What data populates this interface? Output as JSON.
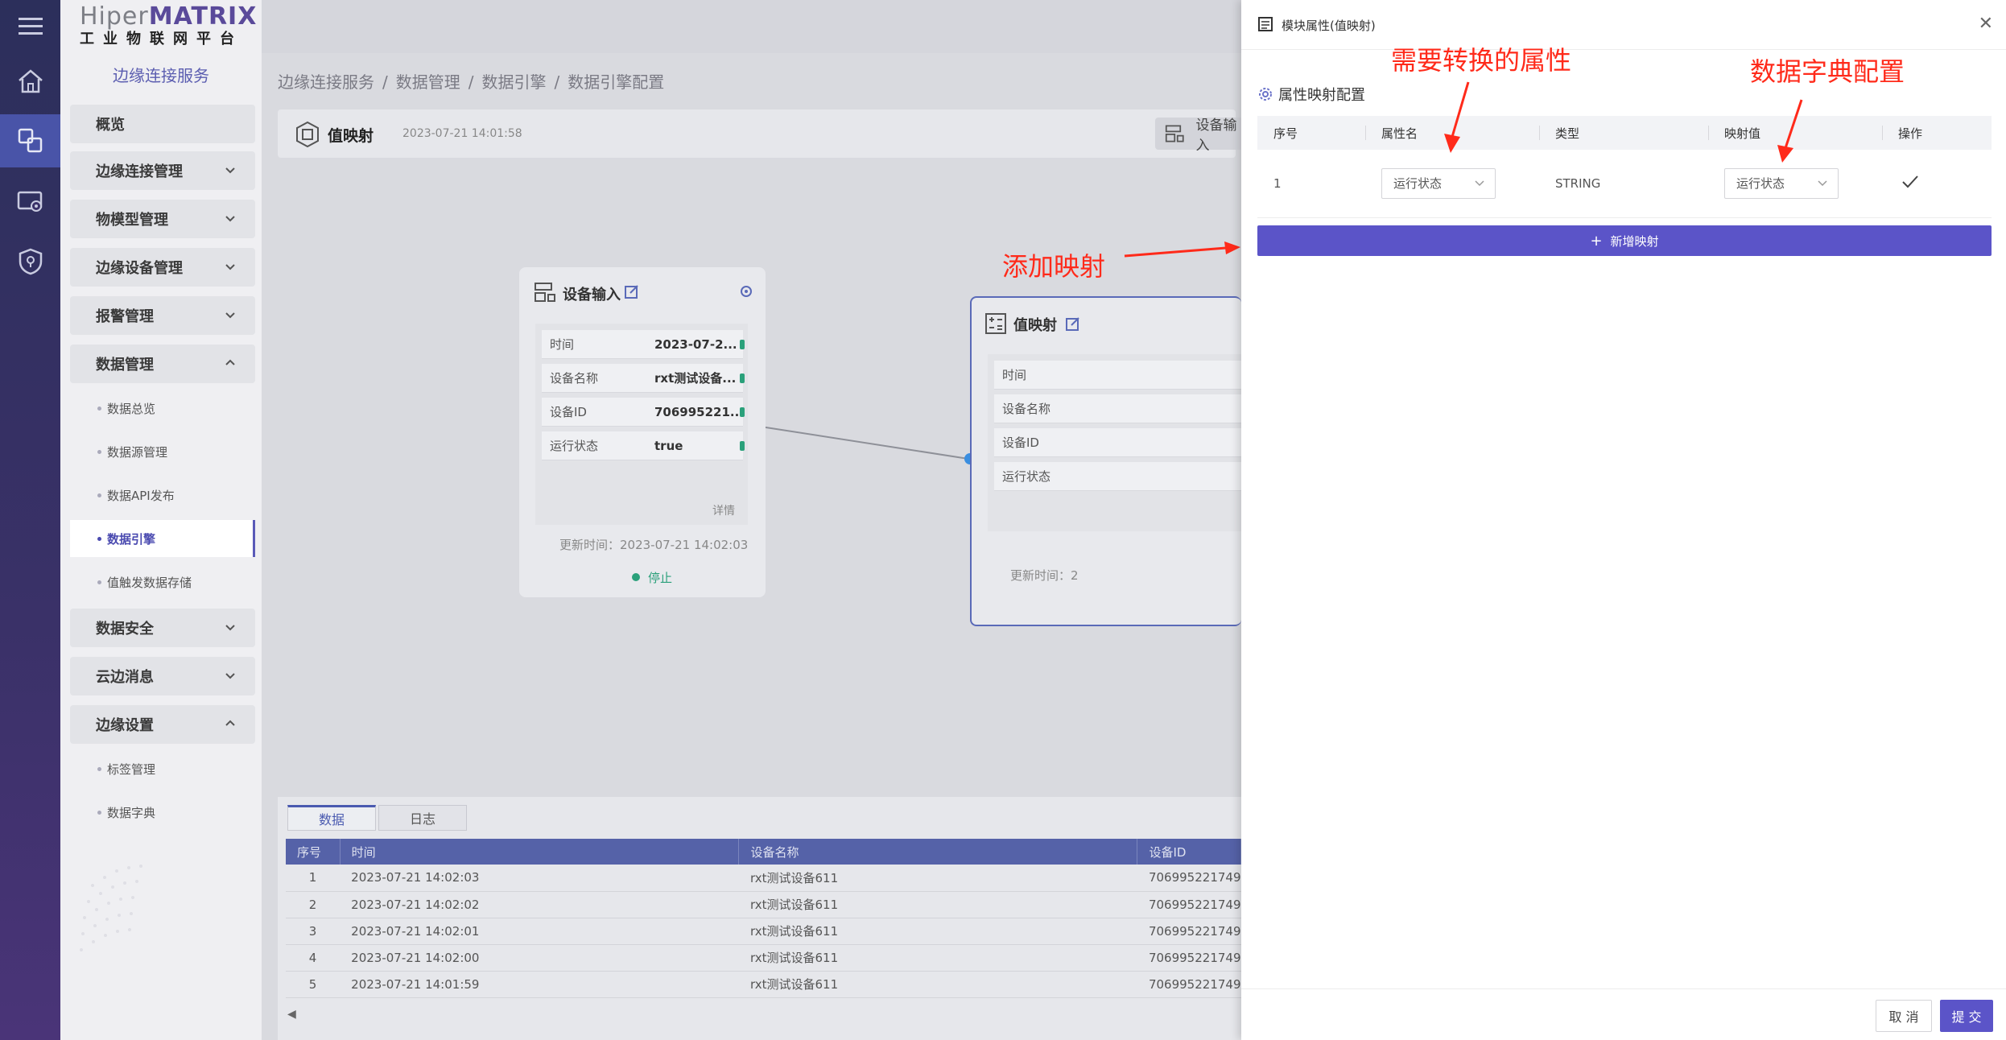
{
  "brand": {
    "logo_main_a": "Hiper",
    "logo_main_b": "MATRIX",
    "logo_sub": "工业物联网平台"
  },
  "sidebar": {
    "service_title": "边缘连接服务",
    "items": [
      {
        "label": "概览"
      },
      {
        "label": "边缘连接管理"
      },
      {
        "label": "物模型管理"
      },
      {
        "label": "边缘设备管理"
      },
      {
        "label": "报警管理"
      },
      {
        "label": "数据管理"
      },
      {
        "label": "数据安全"
      },
      {
        "label": "云边消息"
      },
      {
        "label": "边缘设置"
      }
    ],
    "data_sub": [
      "数据总览",
      "数据源管理",
      "数据API发布",
      "数据引擎",
      "值触发数据存储"
    ],
    "settings_sub": [
      "标签管理",
      "数据字典"
    ]
  },
  "breadcrumb": [
    "边缘连接服务",
    "数据管理",
    "数据引擎",
    "数据引擎配置"
  ],
  "engine_header": {
    "title": "值映射",
    "time": "2023-07-21 14:01:58",
    "btn_label": "设备输入"
  },
  "node_input": {
    "title": "设备输入",
    "rows": [
      {
        "k": "时间",
        "v": "2023-07-2..."
      },
      {
        "k": "设备名称",
        "v": "rxt测试设备..."
      },
      {
        "k": "设备ID",
        "v": "706995221..."
      },
      {
        "k": "运行状态",
        "v": "true"
      }
    ],
    "detail": "详情",
    "updated": "更新时间：2023-07-21 14:02:03",
    "status": "停止"
  },
  "node_map": {
    "title": "值映射",
    "rows": [
      "时间",
      "设备名称",
      "设备ID",
      "运行状态"
    ],
    "updated": "更新时间：2"
  },
  "bottom": {
    "tabs": [
      "数据",
      "日志"
    ],
    "columns": [
      "序号",
      "时间",
      "设备名称",
      "设备ID"
    ],
    "rows": [
      [
        "1",
        "2023-07-21 14:02:03",
        "rxt测试设备611",
        "706995221749"
      ],
      [
        "2",
        "2023-07-21 14:02:02",
        "rxt测试设备611",
        "706995221749"
      ],
      [
        "3",
        "2023-07-21 14:02:01",
        "rxt测试设备611",
        "706995221749"
      ],
      [
        "4",
        "2023-07-21 14:02:00",
        "rxt测试设备611",
        "706995221749"
      ],
      [
        "5",
        "2023-07-21 14:01:59",
        "rxt测试设备611",
        "706995221749"
      ]
    ]
  },
  "annotations": {
    "attr": "需要转换的属性",
    "dict": "数据字典配置",
    "add": "添加映射"
  },
  "drawer": {
    "title": "模块属性(值映射)",
    "section": "属性映射配置",
    "columns": [
      "序号",
      "属性名",
      "类型",
      "映射值",
      "操作"
    ],
    "row": {
      "idx": "1",
      "attr": "运行状态",
      "type": "STRING",
      "map": "运行状态"
    },
    "add_label": "新增映射",
    "cancel": "取 消",
    "submit": "提 交"
  },
  "colors": {
    "accent": "#5b54c8",
    "annotation": "#ff2a1a",
    "port": "#2aa07a"
  }
}
